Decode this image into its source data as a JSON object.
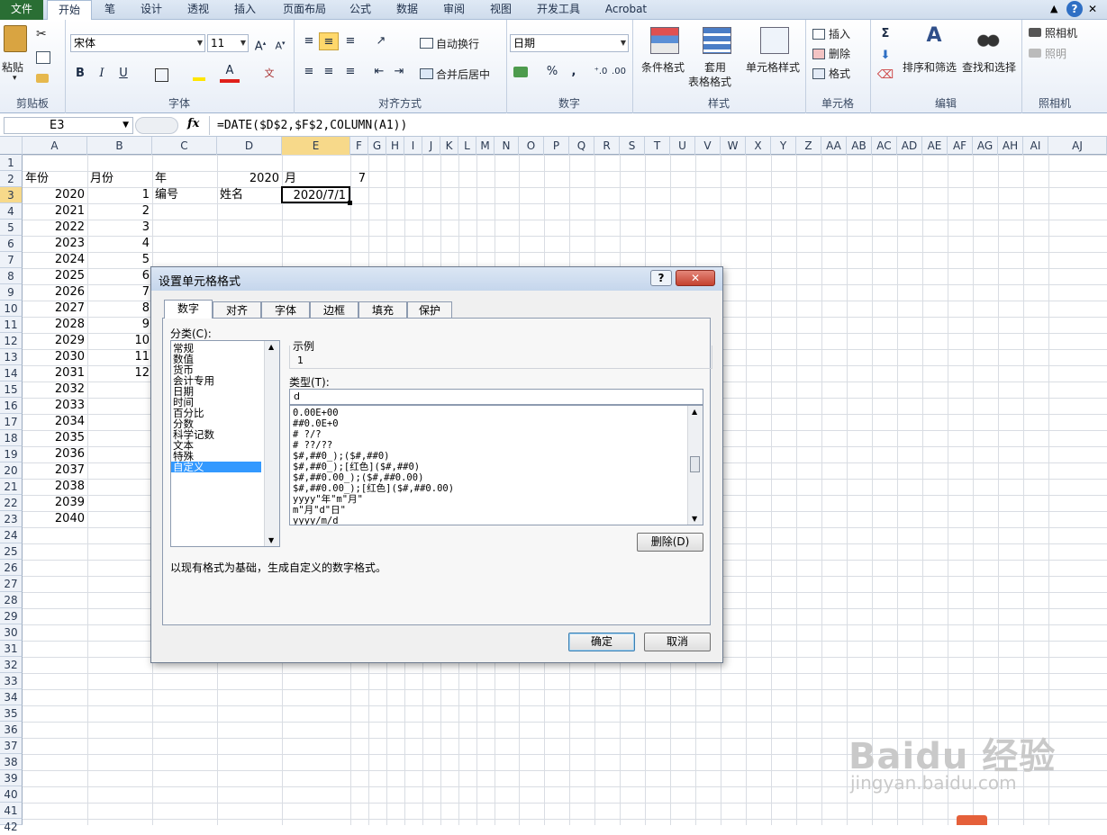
{
  "tabs": [
    "文件",
    "开始",
    "笔",
    "设计",
    "透视",
    "插入",
    "页面布局",
    "公式",
    "数据",
    "审阅",
    "视图",
    "开发工具",
    "Acrobat"
  ],
  "ribbon": {
    "clipboard": {
      "paste": "粘贴",
      "label": "剪贴板"
    },
    "font": {
      "name": "宋体",
      "size": "11",
      "label": "字体",
      "bold": "B",
      "italic": "I",
      "underline": "U"
    },
    "align": {
      "wrap": "自动换行",
      "merge": "合并后居中",
      "label": "对齐方式"
    },
    "number": {
      "format": "日期",
      "percent": "%",
      "comma": ",",
      "label": "数字"
    },
    "styles": {
      "cond": "条件格式",
      "table1": "套用",
      "table2": "表格格式",
      "cell": "单元格样式",
      "label": "样式"
    },
    "cells": {
      "insert": "插入",
      "delete": "删除",
      "format": "格式",
      "label": "单元格"
    },
    "edit": {
      "sort": "排序和筛选",
      "find": "查找和选择",
      "label": "编辑"
    },
    "camera": {
      "cam": "照相机",
      "photo": "照明",
      "label": "照相机"
    }
  },
  "formula_bar": {
    "namebox": "E3",
    "fx": "fx",
    "formula": "=DATE($D$2,$F$2,COLUMN(A1))"
  },
  "columns": [
    "A",
    "B",
    "C",
    "D",
    "E",
    "F",
    "G",
    "H",
    "I",
    "J",
    "K",
    "L",
    "M",
    "N",
    "O",
    "P",
    "Q",
    "R",
    "S",
    "T",
    "U",
    "V",
    "W",
    "X",
    "Y",
    "Z",
    "AA",
    "AB",
    "AC",
    "AD",
    "AE",
    "AF",
    "AG",
    "AH",
    "AI",
    "AJ"
  ],
  "rows": [
    "1",
    "2",
    "3",
    "4",
    "5",
    "6",
    "7",
    "8",
    "9",
    "10",
    "11",
    "12",
    "13",
    "14",
    "15",
    "16",
    "17",
    "18",
    "19",
    "20",
    "21",
    "22",
    "23",
    "24",
    "25",
    "26",
    "27",
    "28",
    "29",
    "30",
    "31",
    "32",
    "33",
    "34",
    "35",
    "36",
    "37",
    "38",
    "39",
    "40",
    "41",
    "42"
  ],
  "cells": {
    "A2": "年份",
    "B2": "月份",
    "C2": "年",
    "D2": "2020",
    "E2": "月",
    "F2": "7",
    "C3": "编号",
    "D3": "姓名",
    "E3": "2020/7/1",
    "years": [
      "2020",
      "2021",
      "2022",
      "2023",
      "2024",
      "2025",
      "2026",
      "2027",
      "2028",
      "2029",
      "2030",
      "2031",
      "2032",
      "2033",
      "2034",
      "2035",
      "2036",
      "2037",
      "2038",
      "2039",
      "2040"
    ],
    "months": [
      "1",
      "2",
      "3",
      "4",
      "5",
      "6",
      "7",
      "8",
      "9",
      "10",
      "11",
      "12"
    ]
  },
  "dialog": {
    "title": "设置单元格格式",
    "help": "?",
    "close": "✕",
    "tabs": [
      "数字",
      "对齐",
      "字体",
      "边框",
      "填充",
      "保护"
    ],
    "category_label": "分类(C):",
    "categories": [
      "常规",
      "数值",
      "货币",
      "会计专用",
      "日期",
      "时间",
      "百分比",
      "分数",
      "科学记数",
      "文本",
      "特殊",
      "自定义"
    ],
    "sample_label": "示例",
    "sample_value": "1",
    "type_label": "类型(T):",
    "type_value": "d",
    "formats": [
      "0.00E+00",
      "##0.0E+0",
      "# ?/?",
      "# ??/??",
      "$#,##0_);($#,##0)",
      "$#,##0_);[红色]($#,##0)",
      "$#,##0.00_);($#,##0.00)",
      "$#,##0.00_);[红色]($#,##0.00)",
      "yyyy\"年\"m\"月\"",
      "m\"月\"d\"日\"",
      "yyyy/m/d"
    ],
    "delete_btn": "删除(D)",
    "description": "以现有格式为基础，生成自定义的数字格式。",
    "ok": "确定",
    "cancel": "取消"
  },
  "watermark": {
    "brand": "Baidu 经验",
    "url": "jingyan.baidu.com"
  }
}
